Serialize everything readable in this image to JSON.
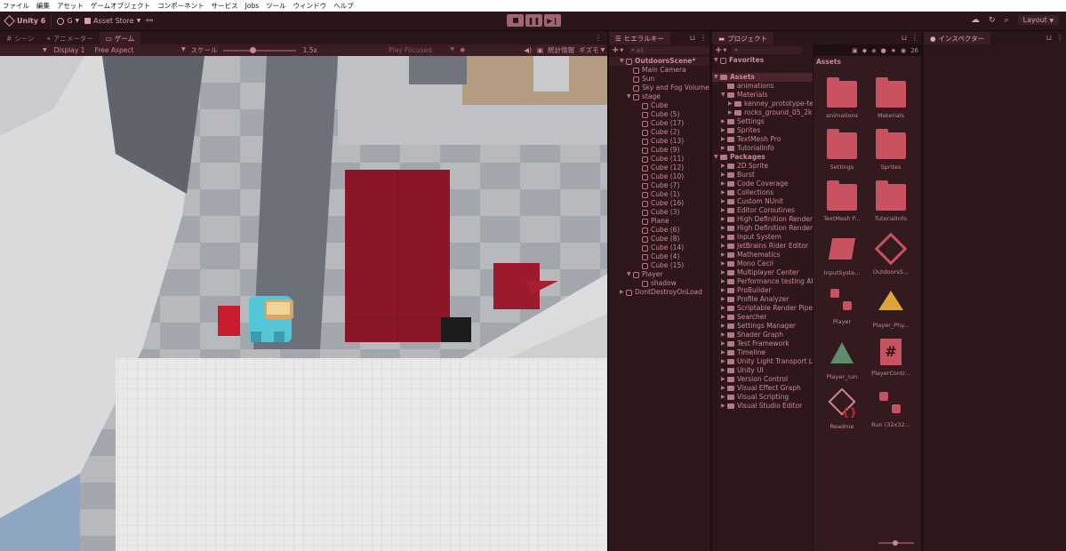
{
  "menu": [
    "ファイル",
    "編集",
    "アセット",
    "ゲームオブジェクト",
    "コンポーネント",
    "サービス",
    "Jobs",
    "ツール",
    "ウィンドウ",
    "ヘルプ"
  ],
  "toolbar": {
    "unity_label": "Unity 6",
    "account": "G",
    "asset_store": "Asset Store",
    "layout": "Layout"
  },
  "left_tabs": [
    "シーン",
    "アニメーター",
    "ゲーム"
  ],
  "game_bar": {
    "display": "Display 1",
    "aspect": "Free Aspect",
    "scale_label": "スケール",
    "scale_value": "1.5x",
    "play_mode": "Play Focused",
    "stats": "統計情報",
    "gizmos": "ギズモ"
  },
  "hierarchy": {
    "tab": "ヒエラルキー",
    "search_placeholder": "All",
    "scene": "OutdoorsScene*",
    "items": [
      "Main Camera",
      "Sun",
      "Sky and Fog Volume",
      "stage"
    ],
    "stage_children": [
      "Cube",
      "Cube (5)",
      "Cube (17)",
      "Cube (2)",
      "Cube (13)",
      "Cube (9)",
      "Cube (11)",
      "Cube (12)",
      "Cube (10)",
      "Cube (7)",
      "Cube (1)",
      "Cube (16)",
      "Cube (3)",
      "Plane",
      "Cube (6)",
      "Cube (8)",
      "Cube (14)",
      "Cube (4)",
      "Cube (15)"
    ],
    "player": "Player",
    "player_child": "shadow",
    "dontdestroy": "DontDestroyOnLoad"
  },
  "project": {
    "tab": "プロジェクト",
    "count": "26",
    "favorites": "Favorites",
    "assets_root": "Assets",
    "assets_children": [
      "animations",
      "Materials",
      "Settings",
      "Sprites",
      "TextMesh Pro",
      "TutorialInfo"
    ],
    "materials_children": [
      "kenney_prototype-textures",
      "rocks_ground_05_2k"
    ],
    "packages": "Packages",
    "package_list": [
      "2D Sprite",
      "Burst",
      "Code Coverage",
      "Collections",
      "Custom NUnit",
      "Editor Coroutines",
      "High Definition Render Pipeline",
      "High Definition Render Pipeline Config",
      "Input System",
      "JetBrains Rider Editor",
      "Mathematics",
      "Mono Cecil",
      "Multiplayer Center",
      "Performance testing API",
      "ProBuilder",
      "Profile Analyzer",
      "Scriptable Render Pipeline",
      "Searcher",
      "Settings Manager",
      "Shader Graph",
      "Test Framework",
      "Timeline",
      "Unity Light Transport Library",
      "Unity UI",
      "Version Control",
      "Visual Effect Graph",
      "Visual Scripting",
      "Visual Studio Editor"
    ],
    "grid_title": "Assets",
    "grid_items": [
      "animations",
      "Materials",
      "Settings",
      "Sprites",
      "TextMesh P...",
      "TutorialInfo",
      "InputSyste...",
      "OutdoorsS...",
      "Player",
      "Player_Phy...",
      "Player_run",
      "PlayerContr...",
      "Readme",
      "Run (32x32..."
    ]
  },
  "inspector": {
    "tab": "インスペクター"
  },
  "colors": {
    "accent": "#c8525f",
    "panel": "#2e171a",
    "text": "#c98b94"
  }
}
